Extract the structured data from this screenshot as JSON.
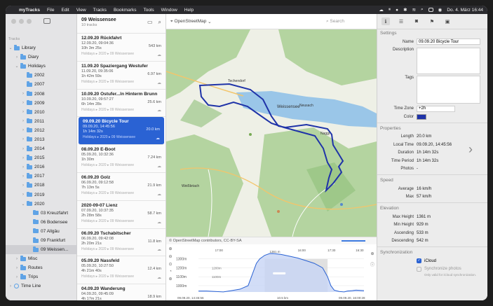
{
  "menubar": {
    "app": "myTracks",
    "items": [
      "File",
      "Edit",
      "View",
      "Tracks",
      "Bookmarks",
      "Tools",
      "Window",
      "Help"
    ],
    "clock": "Do. 4. März  16:44"
  },
  "sidebar": {
    "section": "Tracks",
    "items": [
      {
        "label": "Library",
        "level": 0,
        "chev": "⌄"
      },
      {
        "label": "Diary",
        "level": 1,
        "chev": "›"
      },
      {
        "label": "Holidays",
        "level": 1,
        "chev": "⌄"
      },
      {
        "label": "2002",
        "level": 2,
        "chev": ""
      },
      {
        "label": "2007",
        "level": 2,
        "chev": ""
      },
      {
        "label": "2008",
        "level": 2,
        "chev": "›"
      },
      {
        "label": "2009",
        "level": 2,
        "chev": "›"
      },
      {
        "label": "2010",
        "level": 2,
        "chev": "›"
      },
      {
        "label": "2011",
        "level": 2,
        "chev": "›"
      },
      {
        "label": "2012",
        "level": 2,
        "chev": "›"
      },
      {
        "label": "2013",
        "level": 2,
        "chev": "›"
      },
      {
        "label": "2014",
        "level": 2,
        "chev": "›"
      },
      {
        "label": "2015",
        "level": 2,
        "chev": "›"
      },
      {
        "label": "2016",
        "level": 2,
        "chev": "›"
      },
      {
        "label": "2017",
        "level": 2,
        "chev": "›"
      },
      {
        "label": "2018",
        "level": 2,
        "chev": "›"
      },
      {
        "label": "2019",
        "level": 2,
        "chev": "›"
      },
      {
        "label": "2020",
        "level": 2,
        "chev": "⌄"
      },
      {
        "label": "03 Kreuzfahrt",
        "level": 3,
        "chev": ""
      },
      {
        "label": "06 Bodensee",
        "level": 3,
        "chev": ""
      },
      {
        "label": "07 Allgäu",
        "level": 3,
        "chev": ""
      },
      {
        "label": "09 Frankfurt",
        "level": 3,
        "chev": ""
      },
      {
        "label": "09 Weissen...",
        "level": 3,
        "chev": "",
        "selected": true
      },
      {
        "label": "Misc",
        "level": 1,
        "chev": "›"
      },
      {
        "label": "Routes",
        "level": 1,
        "chev": "›"
      },
      {
        "label": "Trips",
        "level": 1,
        "chev": "›"
      },
      {
        "label": "Time Line",
        "level": 0,
        "chev": "›",
        "clock": true
      }
    ]
  },
  "tracklist": {
    "title": "09 Weissensee",
    "subtitle": "10 tracks",
    "items": [
      {
        "name": "12.09.20 Rückfahrt",
        "date": "12.09.20, 09:04:36",
        "time": "10h 3m 25s",
        "km": "543 km",
        "path": "Holidays ▸ 2020 ▸ 09 Weissensee"
      },
      {
        "name": "11.09.20 Spaziergang Westufer",
        "date": "11.09.20, 09:35:06",
        "time": "1h 42m 59s",
        "km": "6.97 km",
        "path": "Holidays ▸ 2020 ▸ 09 Weissensee"
      },
      {
        "name": "10.09.20 Ostufer...ln Hinterm Brunn",
        "date": "10.09.20, 09:57:27",
        "time": "6h 14m 28s",
        "km": "25.6 km",
        "path": "Holidays ▸ 2020 ▸ 09 Weissensee"
      },
      {
        "name": "09.09.20 Bicycle Tour",
        "date": "09.09.20, 14:45:56",
        "time": "1h 14m 32s",
        "km": "20.0 km",
        "path": "Holidays ▸ 2020 ▸ 09 Weissensee",
        "selected": true
      },
      {
        "name": "08.09.20 E-Boot",
        "date": "05.09.20, 10:32:36",
        "time": "1h 30m",
        "km": "7.24 km",
        "path": "Holidays ▸ 2020 ▸ 09 Weissensee"
      },
      {
        "name": "06.09.20 Golz",
        "date": "06.09.20, 09:12:58",
        "time": "7h 13m 5s",
        "km": "21.9 km",
        "path": "Holidays ▸ 2020 ▸ 09 Weissensee"
      },
      {
        "name": "2020-09-07 Lienz",
        "date": "07.09.20, 10:37:35",
        "time": "2h 28m 58s",
        "km": "58.7 km",
        "path": "Holidays ▸ 2020 ▸ 09 Weissensee"
      },
      {
        "name": "06.09.20 Tschabitscher",
        "date": "06.09.20, 09:42:08",
        "time": "2h 20m 21s",
        "km": "11.8 km",
        "path": "Holidays ▸ 2020 ▸ 09 Weissensee"
      },
      {
        "name": "05.09.20 Nassfeld",
        "date": "05.09.20, 10:27:50",
        "time": "4h 21m 40s",
        "km": "12.4 km",
        "path": "Holidays ▸ 2020 ▸ 09 Weissensee"
      },
      {
        "name": "04.09.20 Wanderung",
        "date": "04.09.20, 09:45:09",
        "time": "4h 17m 21s",
        "km": "18.9 km",
        "path": "Holidays ▸ 2020 ▸ 09 Weissensee"
      }
    ]
  },
  "map": {
    "source": "OpenStreetMap",
    "search_placeholder": "Search",
    "attribution": "© OpenStreetMap contributors, CC-BY-SA",
    "places": [
      {
        "label": "Weissensee"
      },
      {
        "label": "Techendorf"
      },
      {
        "label": "Neusach"
      },
      {
        "label": "Naggl"
      },
      {
        "label": "Weißbriach"
      }
    ]
  },
  "chart_data": {
    "type": "area",
    "x": [
      0,
      5,
      10,
      15,
      20,
      25,
      30,
      33,
      35,
      37,
      40,
      43,
      45,
      50,
      55,
      60,
      65,
      70,
      75,
      78,
      80,
      82,
      85,
      88,
      90,
      93,
      95,
      100
    ],
    "values": [
      940,
      940,
      935,
      930,
      945,
      960,
      1000,
      1150,
      1250,
      1300,
      1340,
      1360,
      1361,
      1350,
      1330,
      1310,
      1280,
      1250,
      1200,
      1100,
      1000,
      950,
      935,
      930,
      940,
      945,
      950,
      945
    ],
    "y_ticks": [
      "1300m",
      "1200m",
      "1100m",
      "1000m"
    ],
    "ylim": [
      929,
      1400
    ],
    "annotations": [
      "1361.m",
      "17:00",
      "17:30",
      "16:00",
      "16:30"
    ],
    "x_labels": [
      "09.09.20, 14:45:56",
      "09.09.20, 16:00:28"
    ],
    "x_mid_label": "10.5 km",
    "gray_band_labels": [
      "1200m",
      "1100m"
    ]
  },
  "inspector": {
    "settings_title": "Settings",
    "name_label": "Name",
    "name_value": "09.09.20 Bicycle Tour",
    "description_label": "Description",
    "tags_label": "Tags",
    "timezone_label": "Time Zone",
    "timezone_value": "+2h",
    "color_label": "Color",
    "color_value": "#1f33a8",
    "properties_title": "Properties",
    "properties": [
      {
        "label": "Length",
        "value": "20.0 km"
      },
      {
        "label": "Local Time",
        "value": "09.09.20, 14:45:56"
      },
      {
        "label": "Duration",
        "value": "1h 14m 32s"
      },
      {
        "label": "Time Period",
        "value": "1h 14m 32s"
      },
      {
        "label": "Photos",
        "value": "-"
      }
    ],
    "speed_title": "Speed",
    "speed": [
      {
        "label": "Average",
        "value": "16 km/h"
      },
      {
        "label": "Max",
        "value": "57 km/h"
      }
    ],
    "elevation_title": "Elevation",
    "elevation": [
      {
        "label": "Max Height",
        "value": "1361 m"
      },
      {
        "label": "Min Height",
        "value": "929 m"
      },
      {
        "label": "Ascending",
        "value": "533 m"
      },
      {
        "label": "Descending",
        "value": "542 m"
      }
    ],
    "sync_title": "Synchronization",
    "icloud_label": "iCloud",
    "sync_photos_label": "Synchronize photos",
    "sync_note": "Only valid for iCloud synchronization."
  },
  "colors": {
    "selection": "#2a62d3",
    "track": "#1f33a8",
    "lake": "#9ac6e8",
    "forest": "#a9cf93"
  }
}
